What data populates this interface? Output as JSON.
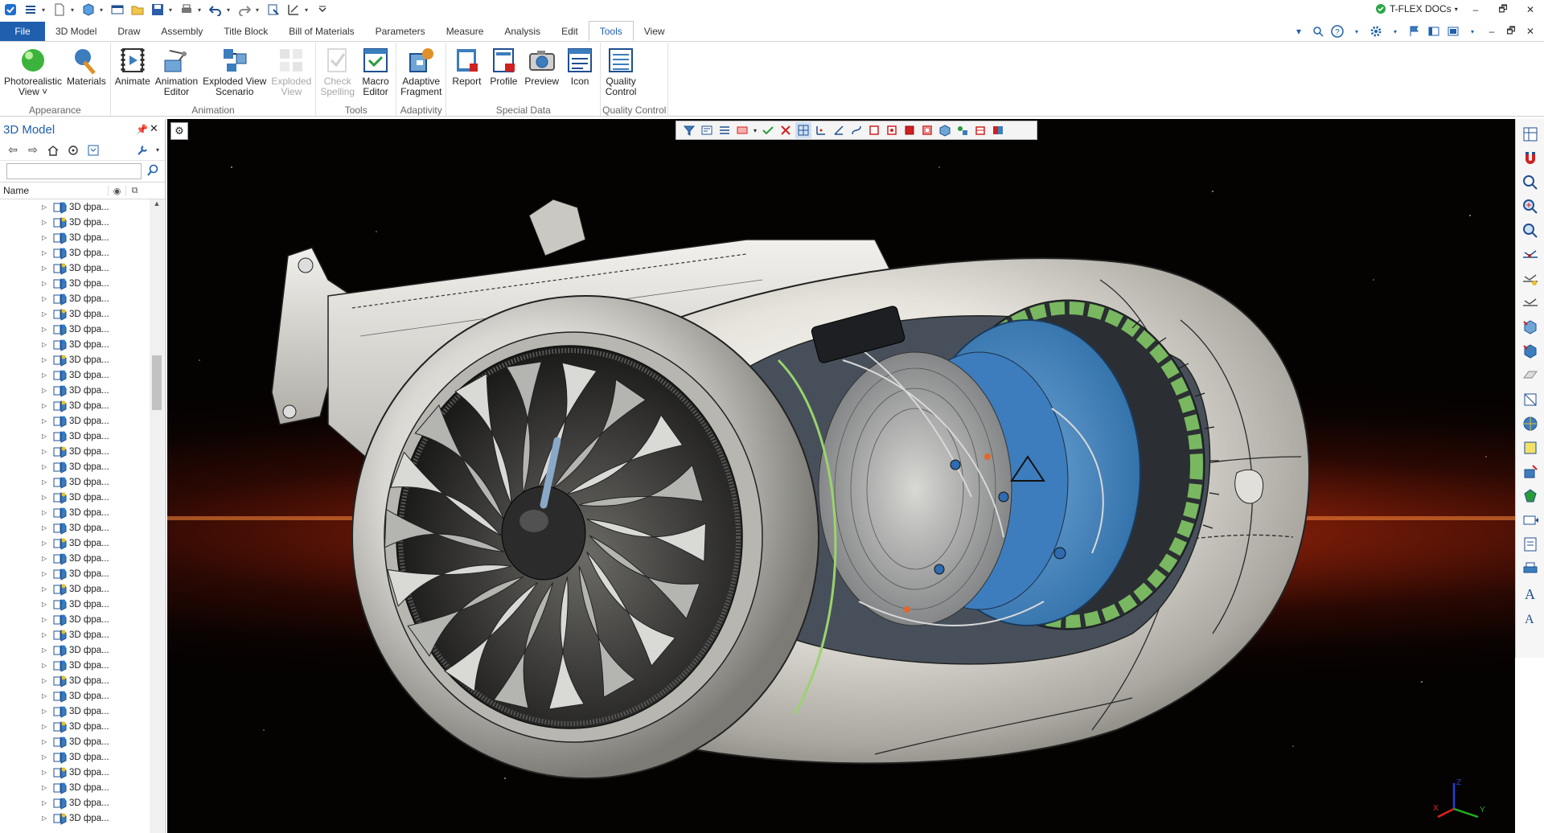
{
  "app": {
    "docs_label": "T-FLEX DOCs",
    "window_controls": [
      "–",
      "🗗",
      "✕"
    ]
  },
  "quick_access": [
    "app-icon",
    "menu-icon",
    "new-document-icon",
    "3d-cube-icon",
    "window-icon",
    "open-folder-icon",
    "save-icon",
    "print-icon",
    "undo-icon",
    "redo-icon",
    "export-icon",
    "measure-icon",
    "customize-icon"
  ],
  "tabs": [
    {
      "label": "File",
      "kind": "file"
    },
    {
      "label": "3D Model"
    },
    {
      "label": "Draw"
    },
    {
      "label": "Assembly"
    },
    {
      "label": "Title Block"
    },
    {
      "label": "Bill of Materials"
    },
    {
      "label": "Parameters"
    },
    {
      "label": "Measure"
    },
    {
      "label": "Analysis"
    },
    {
      "label": "Edit"
    },
    {
      "label": "Tools",
      "active": true
    },
    {
      "label": "View"
    }
  ],
  "ribbon": {
    "groups": [
      {
        "label": "Appearance",
        "buttons": [
          {
            "label": "Photorealistic\nView ˅",
            "icon": "green-sphere-icon"
          },
          {
            "label": "Materials",
            "icon": "materials-brush-icon"
          }
        ]
      },
      {
        "label": "Animation",
        "buttons": [
          {
            "label": "Animate",
            "icon": "film-icon"
          },
          {
            "label": "Animation\nEditor",
            "icon": "animation-editor-icon"
          },
          {
            "label": "Exploded View\nScenario",
            "icon": "exploded-scenario-icon"
          },
          {
            "label": "Exploded\nView",
            "icon": "exploded-view-icon",
            "disabled": true
          }
        ]
      },
      {
        "label": "Tools",
        "buttons": [
          {
            "label": "Check\nSpelling",
            "icon": "check-spelling-icon",
            "disabled": true
          },
          {
            "label": "Macro\nEditor",
            "icon": "macro-editor-icon"
          }
        ]
      },
      {
        "label": "Adaptivity",
        "buttons": [
          {
            "label": "Adaptive\nFragment",
            "icon": "adaptive-fragment-icon"
          }
        ]
      },
      {
        "label": "Special Data",
        "buttons": [
          {
            "label": "Report",
            "icon": "report-icon"
          },
          {
            "label": "Profile",
            "icon": "profile-icon"
          },
          {
            "label": "Preview",
            "icon": "camera-icon"
          },
          {
            "label": "Icon",
            "icon": "icon-editor-icon"
          }
        ]
      },
      {
        "label": "Quality Control",
        "buttons": [
          {
            "label": "Quality\nControl",
            "icon": "quality-control-icon"
          }
        ]
      }
    ]
  },
  "panel": {
    "title": "3D Model",
    "pin": "📌",
    "close": "✕",
    "filter_value": "",
    "column_name": "Name",
    "tree_items": [
      "3D фра...",
      "3D фра...",
      "3D фра...",
      "3D фра...",
      "3D фра...",
      "3D фра...",
      "3D фра...",
      "3D фра...",
      "3D фра...",
      "3D фра...",
      "3D фра...",
      "3D фра...",
      "3D фра...",
      "3D фра...",
      "3D фра...",
      "3D фра...",
      "3D фра...",
      "3D фра...",
      "3D фра...",
      "3D фра...",
      "3D фра...",
      "3D фра...",
      "3D фра...",
      "3D фра...",
      "3D фра...",
      "3D фра...",
      "3D фра...",
      "3D фра...",
      "3D фра...",
      "3D фра...",
      "3D фра...",
      "3D фра...",
      "3D фра...",
      "3D фра...",
      "3D фра...",
      "3D фра...",
      "3D фра...",
      "3D фра...",
      "3D фра...",
      "3D фра...",
      "3D фра..."
    ]
  },
  "viewport": {
    "axes": {
      "x": "X",
      "y": "Y",
      "z": "Z"
    },
    "axis_colors": {
      "x": "#e02020",
      "y": "#20b020",
      "z": "#2040e0"
    },
    "accent_blue": "#3b7dbd",
    "accent_green": "#66c24a"
  },
  "right_toolbar_icons": [
    "views-icon",
    "magnet-icon",
    "zoom-window-icon",
    "zoom-in-icon",
    "zoom-fit-icon",
    "snap-1-icon",
    "snap-2-icon",
    "snap-3-icon",
    "cube-view-1-icon",
    "cube-view-2-icon",
    "plane-icon",
    "section-icon",
    "globe-icon",
    "face-icon",
    "selection-icon",
    "body-icon",
    "camera-arrow-icon",
    "page-icon",
    "printer-icon",
    "text-a-icon",
    "text-a2-icon"
  ]
}
